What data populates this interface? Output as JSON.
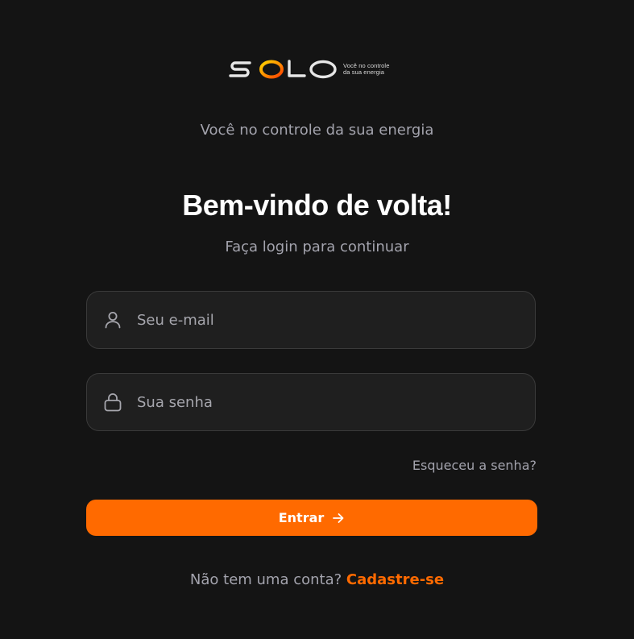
{
  "brand": {
    "logo_text": "SOLO",
    "tagline_line1": "Você no controle",
    "tagline_line2": "da sua energia",
    "accent_color": "#ff6a00"
  },
  "header": {
    "subtitle": "Você no controle da sua energia"
  },
  "login": {
    "title": "Bem-vindo de volta!",
    "hint": "Faça login para continuar",
    "email": {
      "placeholder": "Seu e-mail",
      "value": "",
      "icon": "user-icon"
    },
    "password": {
      "placeholder": "Sua senha",
      "value": "",
      "icon": "lock-icon"
    },
    "forgot_label": "Esqueceu a senha?",
    "submit_label": "Entrar",
    "submit_icon": "arrow-right-icon"
  },
  "signup": {
    "prompt": "Não tem uma conta?",
    "link_label": "Cadastre-se"
  }
}
